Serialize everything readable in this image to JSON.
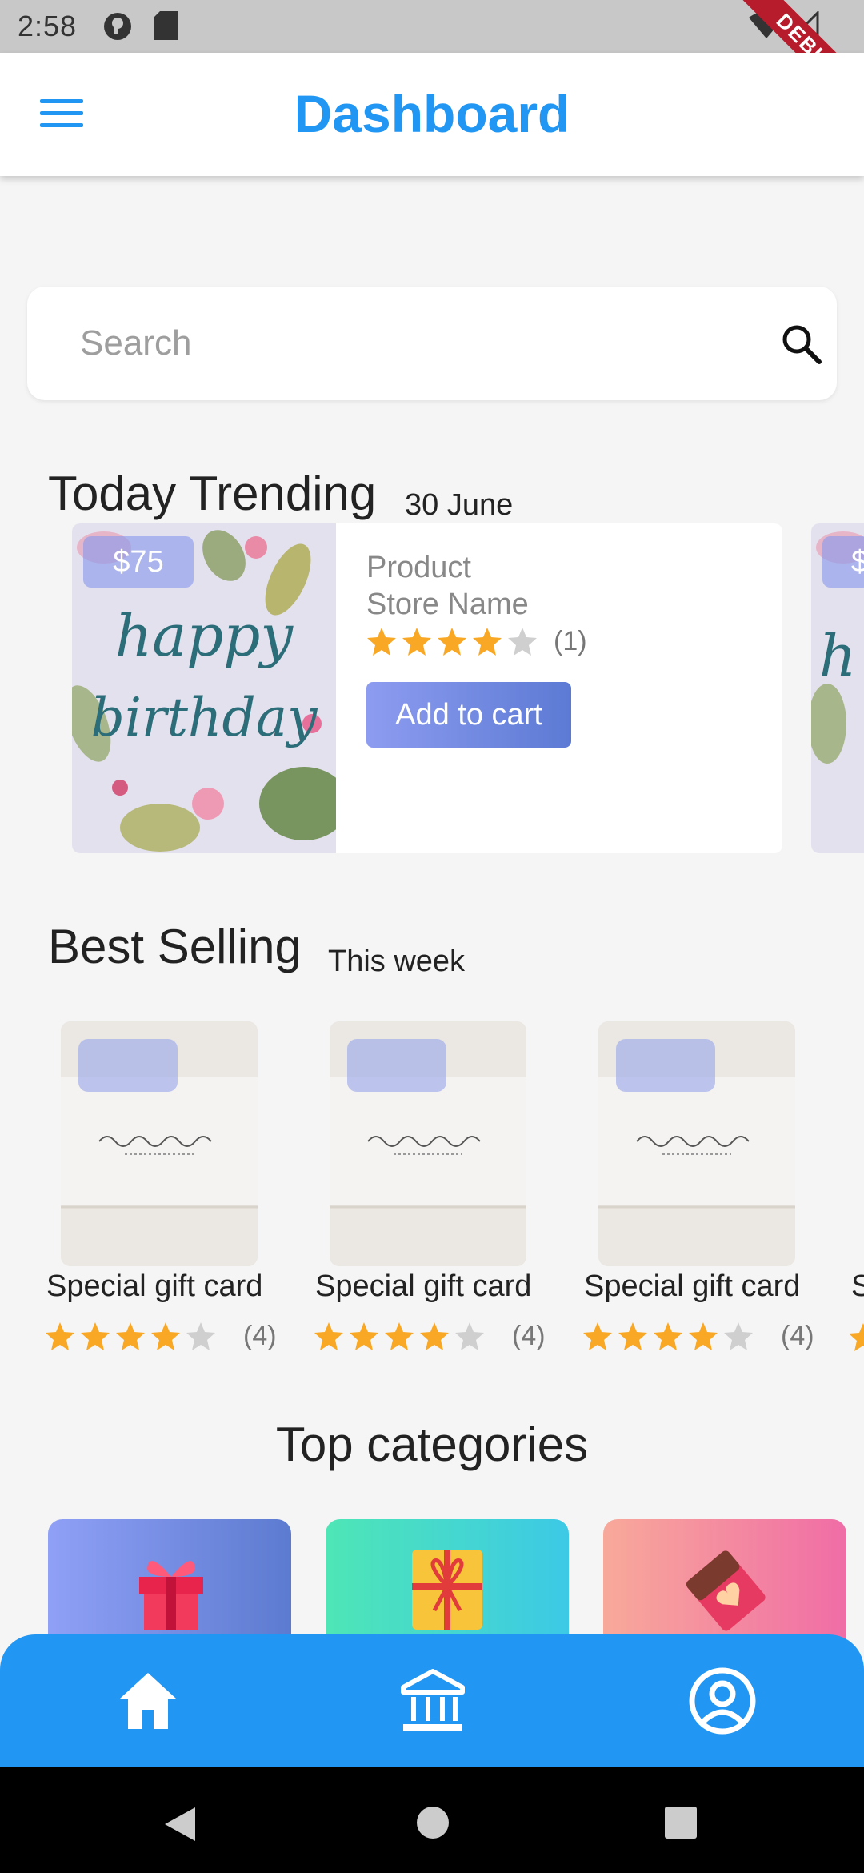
{
  "status_bar": {
    "time": "2:58",
    "debug_label": "DEBUG"
  },
  "app_bar": {
    "title": "Dashboard"
  },
  "search": {
    "placeholder": "Search"
  },
  "trending": {
    "title": "Today Trending",
    "date": "30 June",
    "card": {
      "price": "$75",
      "product": "Product",
      "store": "Store Name",
      "rating_stars": 4,
      "rating_max": 5,
      "rating_count": "(1)",
      "cta": "Add to cart"
    },
    "next_card_price_partial": "$"
  },
  "best_selling": {
    "title": "Best Selling",
    "subtitle": "This week",
    "items": [
      {
        "label": "Special  gift card",
        "rating_stars": 4,
        "rating_count": "(4)"
      },
      {
        "label": "Special  gift card",
        "rating_stars": 4,
        "rating_count": "(4)"
      },
      {
        "label": "Special  gift card",
        "rating_stars": 4,
        "rating_count": "(4)"
      }
    ],
    "partial_label": "S"
  },
  "categories": {
    "title": "Top categories",
    "items": [
      {
        "icon": "gift-box-icon"
      },
      {
        "icon": "gift-ribbon-icon"
      },
      {
        "icon": "chocolate-icon"
      }
    ]
  },
  "bottom_nav": [
    {
      "icon": "home-icon"
    },
    {
      "icon": "bank-icon"
    },
    {
      "icon": "account-icon"
    }
  ],
  "colors": {
    "accent": "#2196f3",
    "star": "#f9a825",
    "star_empty": "#cfcfcf",
    "debug": "#b71c2c"
  }
}
